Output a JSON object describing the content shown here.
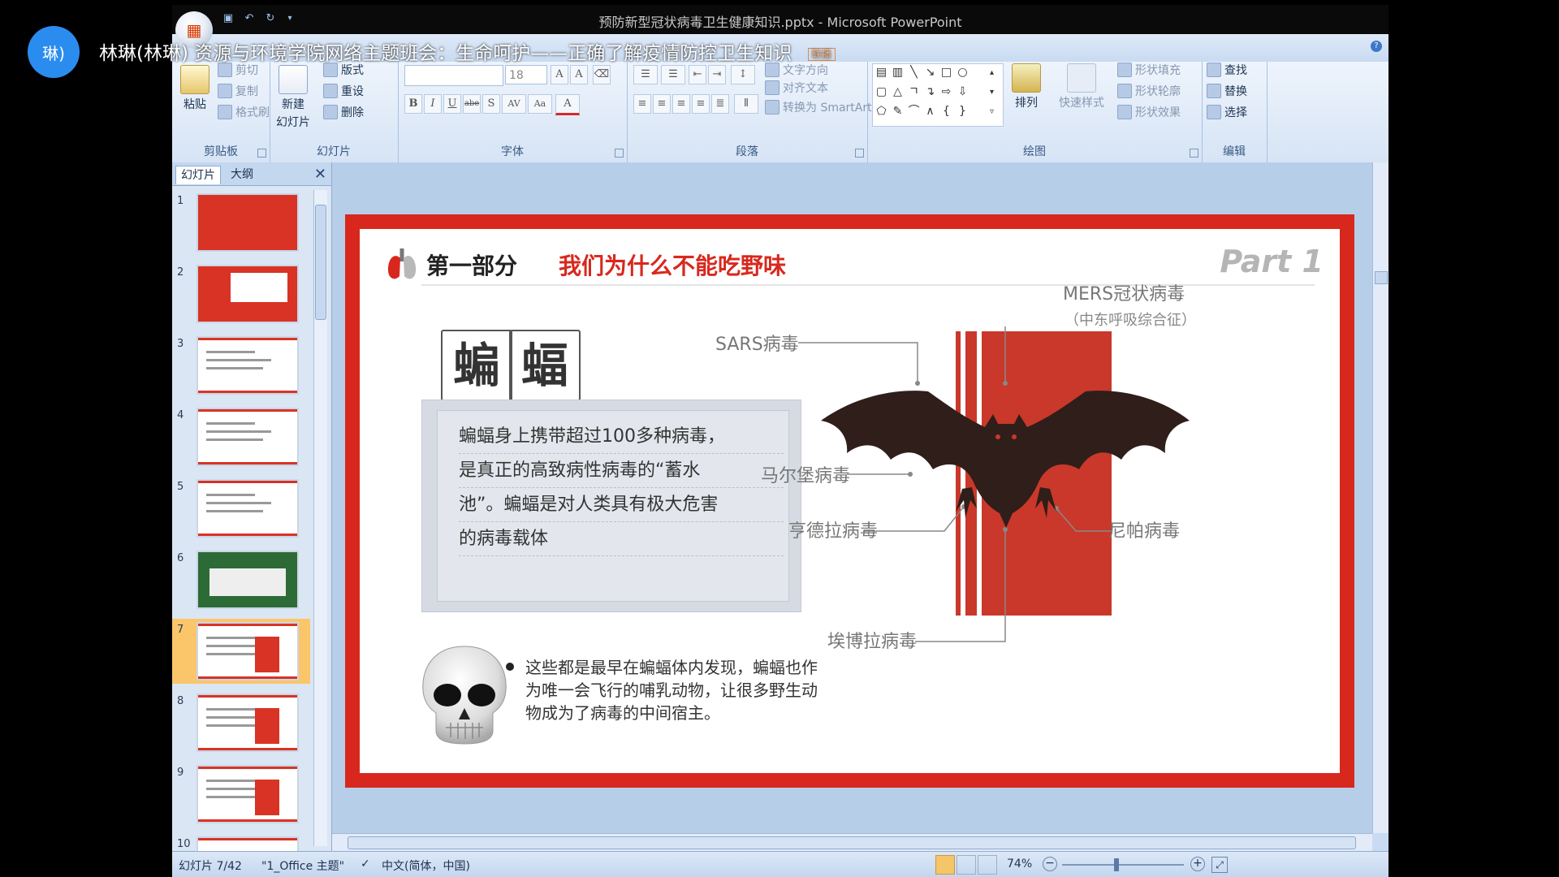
{
  "meeting": {
    "avatar_text": "琳)",
    "title": "林琳(林琳) 资源与环境学院网络主题班会：生命呵护——正确了解疫情防控卫生知识",
    "badge": "联播"
  },
  "window": {
    "title": "预防新型冠状病毒卫生健康知识.pptx - Microsoft PowerPoint"
  },
  "ribbon": {
    "clipboard": {
      "paste": "粘贴",
      "cut": "剪切",
      "copy": "复制",
      "format_painter": "格式刷",
      "label": "剪贴板"
    },
    "slides": {
      "new_slide_line1": "新建",
      "new_slide_line2": "幻灯片",
      "layout": "版式",
      "reset": "重设",
      "delete": "删除",
      "label": "幻灯片"
    },
    "font": {
      "font_size": "18",
      "label": "字体",
      "bold": "B",
      "italic": "I",
      "underline": "U",
      "strike": "abe",
      "shadow": "S",
      "spacing": "AV",
      "case": "Aa",
      "color": "A"
    },
    "paragraph": {
      "text_direction": "文字方向",
      "align_text": "对齐文本",
      "smartart": "转换为 SmartArt",
      "label": "段落"
    },
    "drawing": {
      "arrange": "排列",
      "quick_styles": "快速样式",
      "shape_fill": "形状填充",
      "shape_outline": "形状轮廓",
      "shape_effects": "形状效果",
      "label": "绘图"
    },
    "editing": {
      "find": "查找",
      "replace": "替换",
      "select": "选择",
      "label": "编辑"
    }
  },
  "pane": {
    "tab_slides": "幻灯片",
    "tab_outline": "大纲",
    "thumbnails": [
      "1",
      "2",
      "3",
      "4",
      "5",
      "6",
      "7",
      "8",
      "9",
      "10"
    ],
    "selected_index": 7
  },
  "slide": {
    "section_label": "第一部分",
    "section_title": "我们为什么不能吃野味",
    "part_label": "Part 1",
    "char1": "蝙",
    "char2": "蝠",
    "desc_lines": [
      "蝙蝠身上携带超过100多种病毒，",
      "是真正的高致病性病毒的“蓄水",
      "池”。蝙蝠是对人类具有极大危害",
      "的病毒载体"
    ],
    "bullet_lines": [
      "这些都是最早在蝙蝠体内发现，蝙蝠也作",
      "为唯一会飞行的哺乳动物，让很多野生动",
      "物成为了病毒的中间宿主。"
    ],
    "virus_labels": {
      "sars": "SARS病毒",
      "mers": "MERS冠状病毒",
      "mers_sub": "（中东呼吸综合征）",
      "marburg": "马尔堡病毒",
      "hendra": "亨德拉病毒",
      "nipah": "尼帕病毒",
      "ebola": "埃博拉病毒"
    }
  },
  "status": {
    "slide_info": "幻灯片 7/42",
    "theme": "\"1_Office 主题\"",
    "language": "中文(简体，中国)",
    "zoom": "74%"
  },
  "colors": {
    "slide_red": "#d8281e",
    "avatar_blue": "#2b8cf0"
  }
}
